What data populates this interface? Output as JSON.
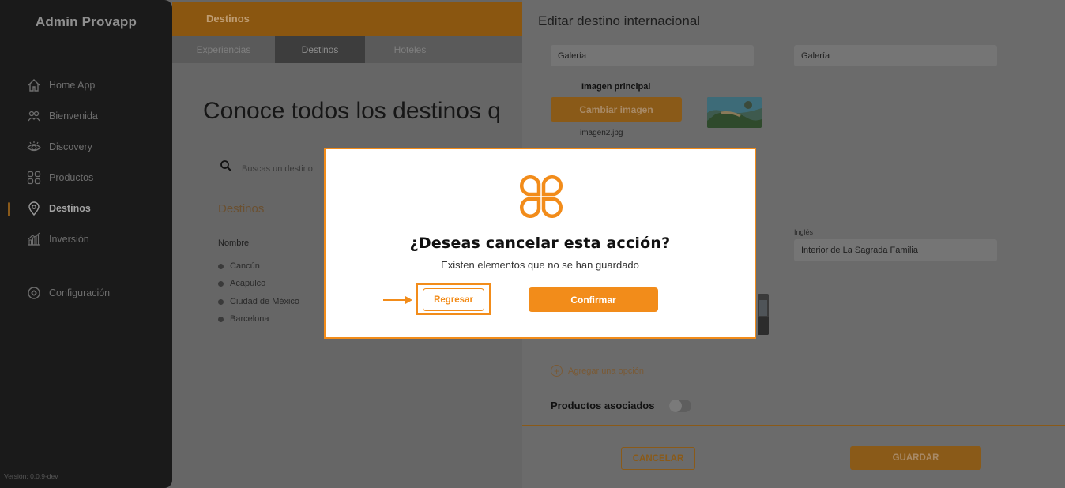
{
  "sidebar": {
    "brand": "Admin Provapp",
    "items": [
      {
        "label": "Home App",
        "icon": "home-icon"
      },
      {
        "label": "Bienvenida",
        "icon": "welcome-icon"
      },
      {
        "label": "Discovery",
        "icon": "eye-icon"
      },
      {
        "label": "Productos",
        "icon": "grid-icon"
      },
      {
        "label": "Destinos",
        "icon": "location-pin-icon",
        "active": true
      },
      {
        "label": "Inversión",
        "icon": "bar-chart-icon"
      }
    ],
    "settings_label": "Configuración",
    "version": "Versión: 0.0.9-dev"
  },
  "header": {
    "title": "Destinos",
    "tabs": [
      "Experiencias",
      "Destinos",
      "Hoteles"
    ],
    "active_tab": "Destinos"
  },
  "main": {
    "heading": "Conoce todos los destinos q",
    "search_placeholder": "Buscas un destino",
    "section_title": "Destinos",
    "column_header": "Nombre",
    "rows": [
      "Cancún",
      "Acapulco",
      "Ciudad de México",
      "Barcelona"
    ]
  },
  "panel": {
    "title": "Editar destino internacional",
    "gallery_es": "Galería",
    "gallery_en": "Galería",
    "image_label": "Imagen principal",
    "change_image_label": "Cambiar imagen",
    "filename": "imagen2.jpg",
    "english_label": "Inglés",
    "english_value": "Interior de La Sagrada Familia",
    "add_option_label": "Agregar una opción",
    "associated_products_label": "Productos asociados",
    "cancel_label": "CANCELAR",
    "save_label": "GUARDAR"
  },
  "modal": {
    "title": "¿Deseas cancelar esta acción?",
    "subtitle": "Existen elementos que no se han guardado",
    "back_label": "Regresar",
    "confirm_label": "Confirmar"
  },
  "colors": {
    "accent": "#f28c1a",
    "dim_accent": "#8a5a18",
    "sidebar_bg": "#1a1a1a",
    "overlay_bg": "#666666"
  }
}
